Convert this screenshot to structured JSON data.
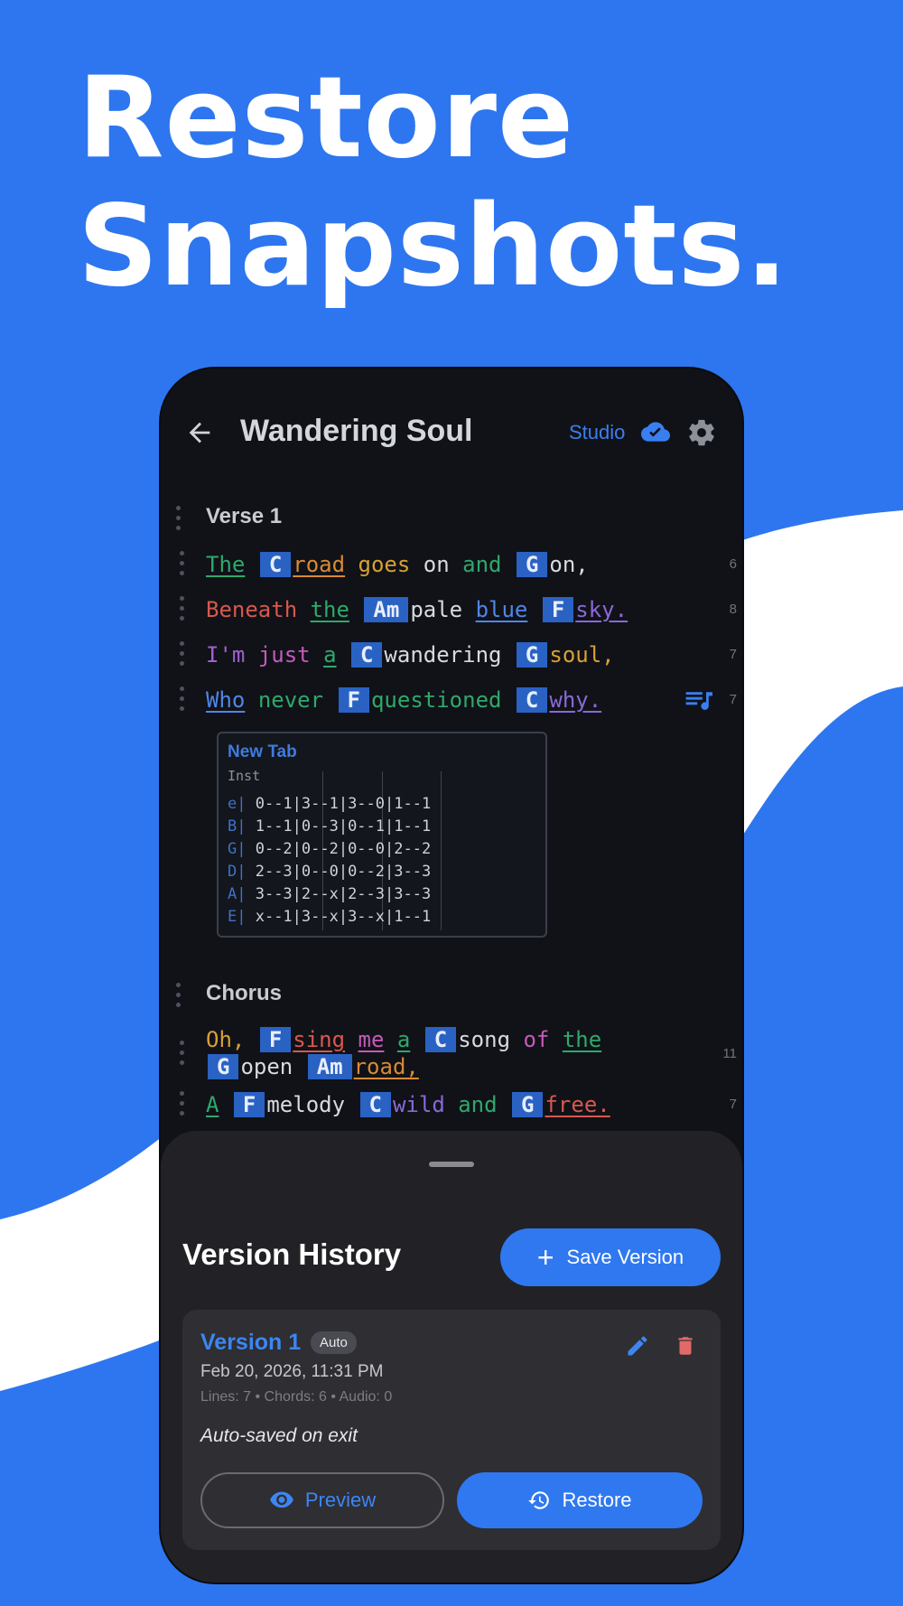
{
  "promo": {
    "line1": "Restore",
    "line2": "Snapshots."
  },
  "topbar": {
    "title": "Wandering Soul",
    "studio": "Studio"
  },
  "sections": [
    {
      "label": "Verse 1"
    },
    {
      "label": "Chorus"
    }
  ],
  "verse_lines": [
    {
      "count": "6"
    },
    {
      "count": "8"
    },
    {
      "count": "7"
    },
    {
      "count": "7"
    }
  ],
  "chorus_lines": [
    {
      "count": "11"
    },
    {
      "count": "7"
    }
  ],
  "lyrics": {
    "l1": {
      "w1": "The",
      "c1": "C",
      "w2": "road",
      "w3": "goes",
      "w4": "on",
      "w5": "and",
      "c2": "G",
      "w6": "on,"
    },
    "l2": {
      "w1": "Beneath",
      "w2": "the",
      "c1": "Am",
      "w3": "pale",
      "w4": "blue",
      "c2": "F",
      "w5": "sky."
    },
    "l3": {
      "w1": "I'm",
      "w2": "just",
      "w3": "a",
      "c1": "C",
      "w4": "wandering",
      "c2": "G",
      "w5": "soul,"
    },
    "l4": {
      "w1": "Who",
      "w2": "never",
      "c1": "F",
      "w3": "questioned",
      "c2": "C",
      "w4": "why."
    },
    "l5a": {
      "w1": "Oh,",
      "c1": "F",
      "w2": "sing",
      "w3": "me",
      "w4": "a",
      "c2": "C",
      "w5": "song",
      "w6": "of",
      "w7": "the"
    },
    "l5b": {
      "c1": "G",
      "w1": "open",
      "c2": "Am",
      "w2": "road,"
    },
    "l6": {
      "w1": "A",
      "c1": "F",
      "w2": "melody",
      "c2": "C",
      "w3": "wild",
      "w4": "and",
      "c3": "G",
      "w5": "free."
    }
  },
  "tab": {
    "title": "New Tab",
    "inst": "Inst",
    "rows": [
      {
        "string": "e|",
        "notes": " 0--1|3--1|3--0|1--1"
      },
      {
        "string": "B|",
        "notes": " 1--1|0--3|0--1|1--1"
      },
      {
        "string": "G|",
        "notes": " 0--2|0--2|0--0|2--2"
      },
      {
        "string": "D|",
        "notes": " 2--3|0--0|0--2|3--3"
      },
      {
        "string": "A|",
        "notes": " 3--3|2--x|2--3|3--3"
      },
      {
        "string": "E|",
        "notes": " x--1|3--x|3--x|1--1"
      }
    ]
  },
  "sheet": {
    "title": "Version History",
    "save_label": "Save Version",
    "version": {
      "name": "Version 1",
      "badge": "Auto",
      "date": "Feb 20, 2026, 11:31 PM",
      "stats": "Lines: 7 • Chords: 6 • Audio: 0",
      "note": "Auto-saved on exit"
    },
    "preview_label": "Preview",
    "restore_label": "Restore"
  },
  "colors": {
    "background": "#2e76f0",
    "accent": "#2f78f0",
    "chord": "#2a62c4",
    "delete": "#e06a6a"
  },
  "icons": [
    "back-arrow-icon",
    "cloud-check-icon",
    "gear-icon",
    "drag-handle-icon",
    "queue-music-icon",
    "plus-icon",
    "edit-icon",
    "delete-icon",
    "eye-icon",
    "history-icon"
  ]
}
